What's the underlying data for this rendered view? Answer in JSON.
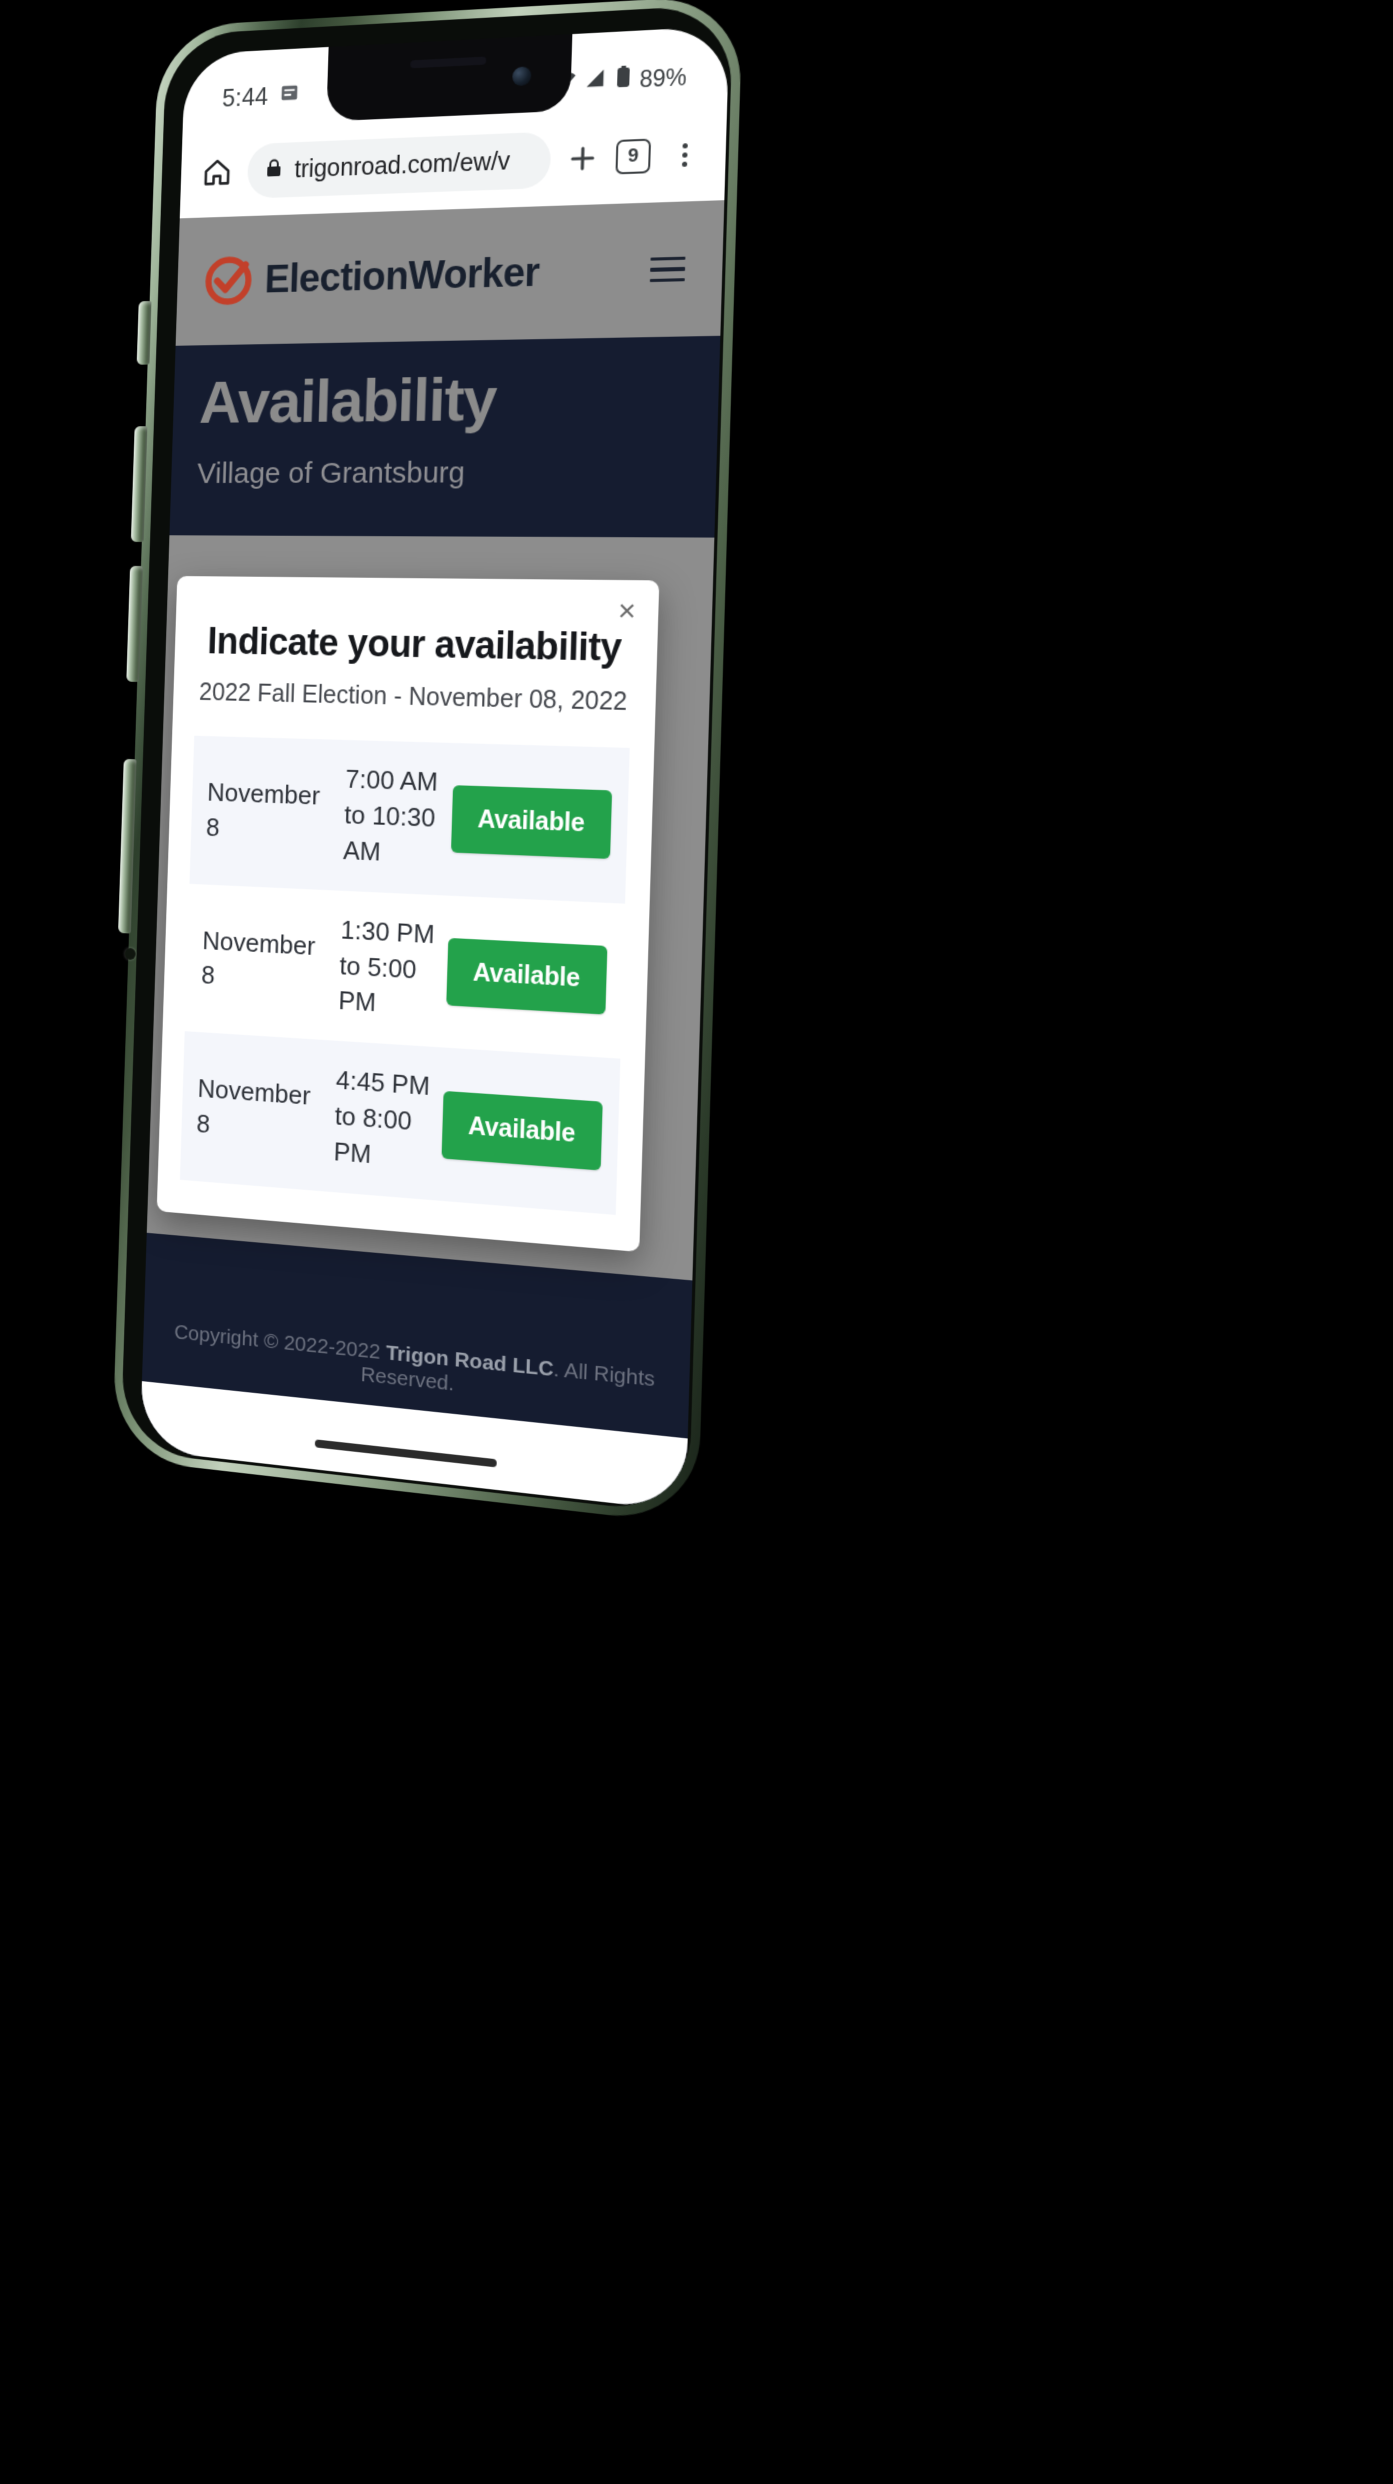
{
  "status_bar": {
    "time": "5:44",
    "notification_icon": "document-icon",
    "wifi_icon": "wifi-icon",
    "signal_icon": "cell-signal-icon",
    "battery_icon": "battery-icon",
    "battery_percent": "89%"
  },
  "browser": {
    "home_icon": "home-icon",
    "lock_icon": "lock-icon",
    "url": "trigonroad.com/ew/v",
    "new_tab_icon": "plus-icon",
    "tab_count": "9",
    "menu_icon": "kebab-menu-icon"
  },
  "site": {
    "brand_name": "ElectionWorker",
    "brand_logo_icon": "checkmark-circle-logo",
    "menu_icon": "hamburger-icon",
    "hero_title": "Availability",
    "hero_subtitle": "Village of Grantsburg"
  },
  "modal": {
    "close_label": "×",
    "title": "Indicate your availability",
    "subtitle": "2022 Fall Election - November 08, 2022",
    "slots": [
      {
        "date": "November 8",
        "time": "7:00 AM to 10:30 AM",
        "button": "Available"
      },
      {
        "date": "November 8",
        "time": "1:30 PM to 5:00 PM",
        "button": "Available"
      },
      {
        "date": "November 8",
        "time": "4:45 PM to 8:00 PM",
        "button": "Available"
      }
    ]
  },
  "footer": {
    "copyright_prefix": "Copyright © 2022-2022 ",
    "copyright_company": "Trigon Road LLC",
    "copyright_suffix": ". All Rights Reserved."
  },
  "colors": {
    "accent_green": "#23a24b",
    "navy": "#151c30",
    "header_gray": "#8d8d8d"
  }
}
